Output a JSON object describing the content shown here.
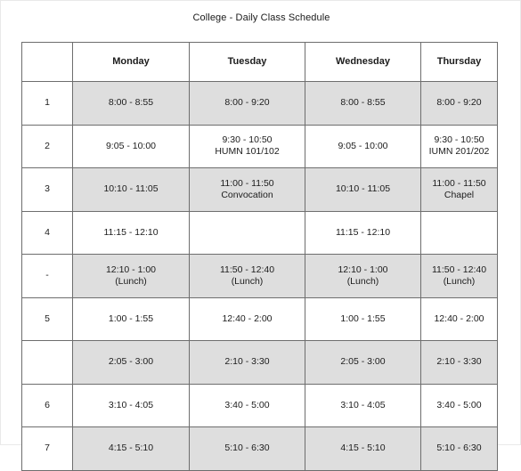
{
  "document": {
    "title": "College - Daily Class Schedule"
  },
  "table": {
    "columns": [
      {
        "key": "period",
        "label": ""
      },
      {
        "key": "monday",
        "label": "Monday"
      },
      {
        "key": "tuesday",
        "label": "Tuesday"
      },
      {
        "key": "wednesday",
        "label": "Wednesday"
      },
      {
        "key": "thursday",
        "label": "Thursday"
      }
    ],
    "rows": [
      {
        "period": "1",
        "shaded": true,
        "monday": {
          "time": "8:00 - 8:55",
          "note": ""
        },
        "tuesday": {
          "time": "8:00 - 9:20",
          "note": ""
        },
        "wednesday": {
          "time": "8:00 - 8:55",
          "note": ""
        },
        "thursday": {
          "time": "8:00 - 9:20",
          "note": ""
        }
      },
      {
        "period": "2",
        "shaded": false,
        "monday": {
          "time": "9:05 - 10:00",
          "note": ""
        },
        "tuesday": {
          "time": "9:30 - 10:50",
          "note": "HUMN 101/102"
        },
        "wednesday": {
          "time": "9:05 - 10:00",
          "note": ""
        },
        "thursday": {
          "time": "9:30 - 10:50",
          "note": "IUMN 201/202"
        }
      },
      {
        "period": "3",
        "shaded": true,
        "monday": {
          "time": "10:10 - 11:05",
          "note": ""
        },
        "tuesday": {
          "time": "11:00 - 11:50",
          "note": "Convocation"
        },
        "wednesday": {
          "time": "10:10 - 11:05",
          "note": ""
        },
        "thursday": {
          "time": "11:00 - 11:50",
          "note": "Chapel"
        }
      },
      {
        "period": "4",
        "shaded": false,
        "monday": {
          "time": "11:15 - 12:10",
          "note": ""
        },
        "tuesday": {
          "time": "",
          "note": ""
        },
        "wednesday": {
          "time": "11:15 - 12:10",
          "note": ""
        },
        "thursday": {
          "time": "",
          "note": ""
        }
      },
      {
        "period": "-",
        "shaded": true,
        "monday": {
          "time": "12:10 - 1:00",
          "note": "(Lunch)"
        },
        "tuesday": {
          "time": "11:50 - 12:40",
          "note": "(Lunch)"
        },
        "wednesday": {
          "time": "12:10 - 1:00",
          "note": "(Lunch)"
        },
        "thursday": {
          "time": "11:50 - 12:40",
          "note": "(Lunch)"
        }
      },
      {
        "period": "5",
        "shaded": false,
        "monday": {
          "time": "1:00 - 1:55",
          "note": ""
        },
        "tuesday": {
          "time": "12:40 - 2:00",
          "note": ""
        },
        "wednesday": {
          "time": "1:00 - 1:55",
          "note": ""
        },
        "thursday": {
          "time": "12:40 - 2:00",
          "note": ""
        }
      },
      {
        "period": "",
        "shaded": true,
        "monday": {
          "time": "2:05 - 3:00",
          "note": ""
        },
        "tuesday": {
          "time": "2:10 - 3:30",
          "note": ""
        },
        "wednesday": {
          "time": "2:05 - 3:00",
          "note": ""
        },
        "thursday": {
          "time": "2:10 - 3:30",
          "note": ""
        }
      },
      {
        "period": "6",
        "shaded": false,
        "monday": {
          "time": "3:10 - 4:05",
          "note": ""
        },
        "tuesday": {
          "time": "3:40 - 5:00",
          "note": ""
        },
        "wednesday": {
          "time": "3:10 - 4:05",
          "note": ""
        },
        "thursday": {
          "time": "3:40 - 5:00",
          "note": ""
        }
      },
      {
        "period": "7",
        "shaded": true,
        "monday": {
          "time": "4:15 - 5:10",
          "note": ""
        },
        "tuesday": {
          "time": "5:10 - 6:30",
          "note": ""
        },
        "wednesday": {
          "time": "4:15 - 5:10",
          "note": ""
        },
        "thursday": {
          "time": "5:10 - 6:30",
          "note": ""
        }
      }
    ]
  },
  "colors": {
    "shaded_cell": "#dedede",
    "plain_cell": "#ffffff",
    "grid_line": "#6e6e6e",
    "text": "#1c1c1c"
  }
}
